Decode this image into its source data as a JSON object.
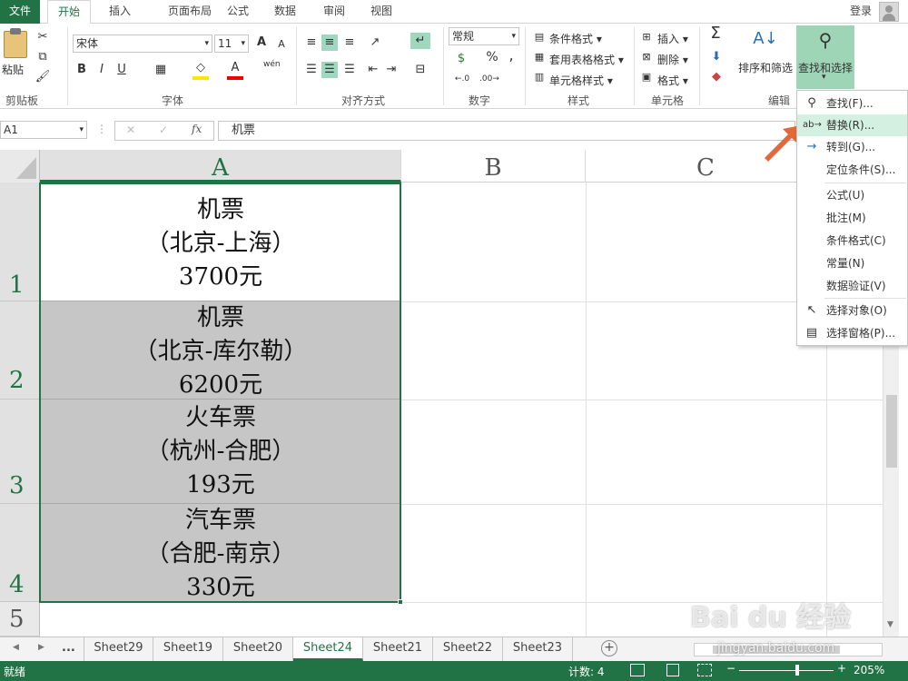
{
  "tabs": {
    "file": "文件",
    "home": "开始",
    "insert": "插入",
    "page_layout": "页面布局",
    "formulas": "公式",
    "data": "数据",
    "review": "审阅",
    "view": "视图",
    "login": "登录"
  },
  "ribbon": {
    "clipboard": {
      "paste": "粘贴",
      "label": "剪贴板"
    },
    "font": {
      "name": "宋体",
      "size": "11",
      "bold": "B",
      "italic": "I",
      "underline": "U",
      "label": "字体",
      "grow": "A",
      "shrink": "A",
      "wen": "wén"
    },
    "alignment": {
      "label": "对齐方式"
    },
    "number": {
      "format": "常规",
      "percent": "%",
      "comma": ",",
      "label": "数字"
    },
    "styles": {
      "conditional": "条件格式",
      "table": "套用表格格式",
      "cell": "单元格样式",
      "label": "样式"
    },
    "cells": {
      "insert": "插入",
      "delete": "删除",
      "format": "格式",
      "label": "单元格"
    },
    "editing": {
      "sort": "排序和筛选",
      "find": "查找和选择",
      "label": "编辑"
    }
  },
  "formula_bar": {
    "name_box": "A1",
    "fx": "fx",
    "content": "机票"
  },
  "columns": [
    "A",
    "B",
    "C"
  ],
  "rows": [
    {
      "num": "1",
      "lines": [
        "机票",
        "（北京-上海）",
        "3700元"
      ]
    },
    {
      "num": "2",
      "lines": [
        "机票",
        "（北京-库尔勒）",
        "6200元"
      ]
    },
    {
      "num": "3",
      "lines": [
        "火车票",
        "（杭州-合肥）",
        "193元"
      ]
    },
    {
      "num": "4",
      "lines": [
        "汽车票",
        "（合肥-南京）",
        "330元"
      ]
    },
    {
      "num": "5",
      "lines": []
    }
  ],
  "dropdown": {
    "find": "查找(F)...",
    "replace": "替换(R)...",
    "goto": "转到(G)...",
    "goto_special": "定位条件(S)...",
    "formulas": "公式(U)",
    "comments": "批注(M)",
    "conditional": "条件格式(C)",
    "constants": "常量(N)",
    "validation": "数据验证(V)",
    "select_objects": "选择对象(O)",
    "selection_pane": "选择窗格(P)..."
  },
  "sheets": [
    "Sheet29",
    "Sheet19",
    "Sheet20",
    "Sheet24",
    "Sheet21",
    "Sheet22",
    "Sheet23"
  ],
  "active_sheet": "Sheet24",
  "ellipsis": "...",
  "status": {
    "ready": "就绪",
    "count": "计数: 4",
    "zoom": "205%"
  },
  "watermark": {
    "brand": "Bai du 经验",
    "url": "jingyan.baidu.com"
  },
  "colors": {
    "accent": "#217346",
    "selected_fill": "#c6c6c6",
    "arrow": "#e2693a"
  }
}
